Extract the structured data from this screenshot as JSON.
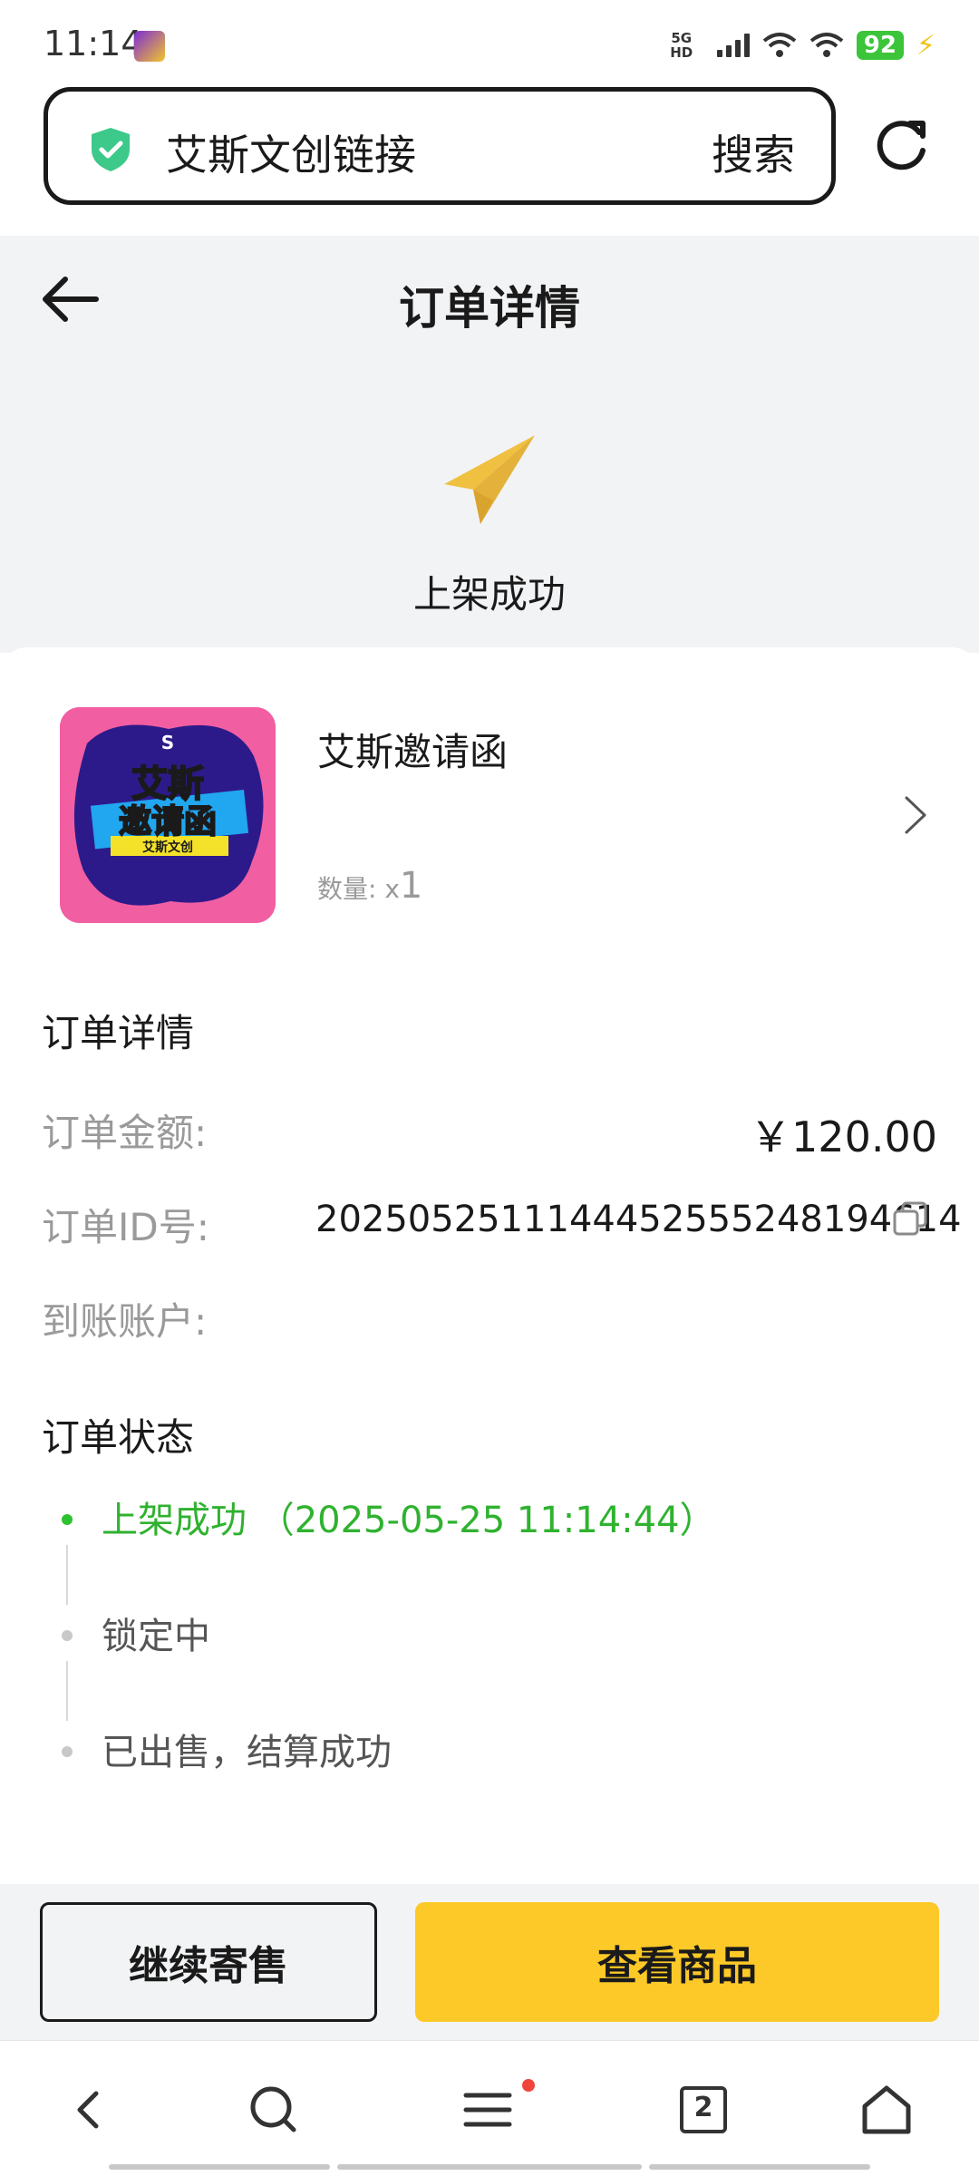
{
  "status_bar": {
    "time": "11:14",
    "network": "5G HD",
    "battery": "92"
  },
  "browser": {
    "search_query": "艾斯文创链接",
    "search_button": "搜索"
  },
  "header": {
    "title": "订单详情",
    "status_text": "上架成功"
  },
  "product": {
    "name": "艾斯邀请函",
    "quantity_label": "数量: ",
    "quantity_prefix": "x",
    "quantity": "1",
    "thumbnail_line1": "艾斯",
    "thumbnail_line2": "邀请函",
    "thumbnail_banner": "艾斯文创"
  },
  "details": {
    "section_title": "订单详情",
    "amount_label": "订单金额:",
    "amount_value": "￥120.00",
    "order_id_label": "订单ID号:",
    "order_id_value": "2025052511144452555248194614",
    "account_label": "到账账户:"
  },
  "order_status": {
    "section_title": "订单状态",
    "steps": [
      {
        "text": "上架成功 （2025-05-25 11:14:44）",
        "active": true
      },
      {
        "text": "锁定中",
        "active": false
      },
      {
        "text": "已出售，结算成功",
        "active": false
      }
    ]
  },
  "actions": {
    "continue_label": "继续寄售",
    "view_label": "查看商品"
  },
  "nav": {
    "tab_count": "2"
  },
  "colors": {
    "accent_yellow": "#fcc928",
    "success_green": "#2fb22f",
    "shield_green": "#3cc98a",
    "plane_yellow": "#f0c040",
    "background_gray": "#f2f3f5"
  }
}
